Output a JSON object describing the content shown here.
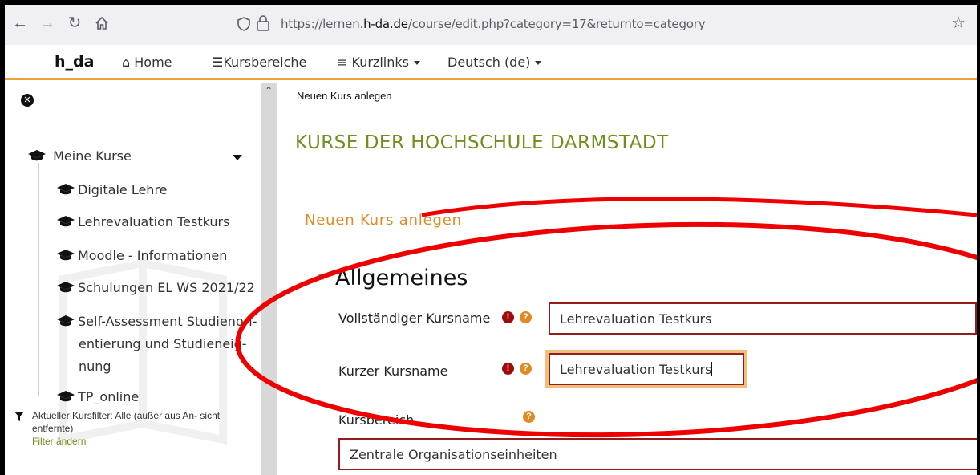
{
  "browser": {
    "url_prefix": "https://lernen.",
    "url_domain": "h-da.de",
    "url_path": "/course/edit.php?category=17&returnto=category"
  },
  "topnav": {
    "brand": "h_da",
    "home": "Home",
    "kursbereiche": "Kursbereiche",
    "kurzlinks": "Kurzlinks",
    "language": "Deutsch (de)"
  },
  "sidebar": {
    "my_courses": "Meine Kurse",
    "courses": [
      "Digitale Lehre",
      "Lehrevaluation Testkurs",
      "Moodle - Informationen",
      "Schulungen EL WS 2021/22",
      "Self-Assessment Studienori-",
      "entierung und Studieneig-",
      "nung",
      "TP_online"
    ],
    "filter_text": "Aktueller Kursfilter: Alle (außer aus An- sicht entfernte)",
    "filter_link": "Filter ändern"
  },
  "main": {
    "breadcrumb": "Neuen Kurs anlegen",
    "page_title": "KURSE DER HOCHSCHULE DARMSTADT",
    "sub_title": "Neuen Kurs anlegen",
    "section": "Allgemeines",
    "fullname_label": "Vollständiger Kursname",
    "fullname_value": "Lehrevaluation Testkurs",
    "shortname_label": "Kurzer Kursname",
    "shortname_value": "Lehrevaluation Testkurs",
    "category_label": "Kursbereich",
    "category_value": "Zentrale Organisationseinheiten"
  },
  "colors": {
    "accent_green": "#6f8f1b",
    "accent_orange": "#e08a26",
    "required_red": "#a10a0a",
    "annotation_red": "#ee0000"
  }
}
